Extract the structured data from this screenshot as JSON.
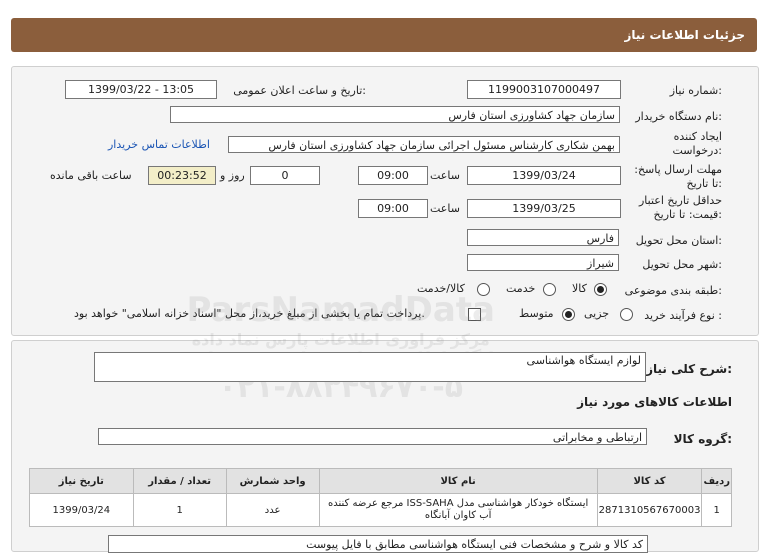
{
  "header": {
    "title": "جزئیات اطلاعات نیاز"
  },
  "form": {
    "need_number_label": "شماره نیاز:",
    "need_number": "1199003107000497",
    "announce_label": "تاریخ و ساعت اعلان عمومی:",
    "announce_value": "1399/03/22 - 13:05",
    "buyer_org_label": "نام دستگاه خریدار:",
    "buyer_org": "سازمان جهاد کشاورزی استان فارس",
    "creator_label": "ایجاد کننده درخواست:",
    "creator": "بهمن شکاری کارشناس مسئول اجرائی سازمان جهاد کشاورزی استان فارس",
    "contact_link": "اطلاعات تماس خریدار",
    "send_deadline_label": "مهلت ارسال پاسخ: تا تاریخ:",
    "send_date": "1399/03/24",
    "time_label": "ساعت",
    "send_time": "09:00",
    "days_value": "0",
    "days_label": "روز و",
    "remaining": "00:23:52",
    "remaining_label": "ساعت باقی مانده",
    "validity_label": "حداقل تاریخ اعتبار قیمت: تا تاریخ:",
    "validity_date": "1399/03/25",
    "validity_time": "09:00",
    "province_label": "استان محل تحویل:",
    "province": "فارس",
    "city_label": "شهر محل تحویل:",
    "city": "شیراز",
    "category_label": "طبقه بندی موضوعی:",
    "category_options": [
      "کالا",
      "خدمت",
      "کالا/خدمت"
    ],
    "process_label": "نوع فرآیند خرید :",
    "process_options": [
      "جزیی",
      "متوسط"
    ],
    "payment_note": "پرداخت تمام یا بخشی از مبلغ خرید،از محل \"اسناد خزانه اسلامی\" خواهد بود."
  },
  "summary": {
    "desc_label": "شرح کلی نیاز:",
    "desc_value": "لوازم ایستگاه هواشناسی",
    "goods_info_title": "اطلاعات کالاهای مورد نیاز",
    "group_label": "گروه کالا:",
    "group_value": "ارتباطی و مخابراتی",
    "watermark_lines": [
      "ParsNamadData",
      "مرکز فراوری اطلاعات پارس نماد داده",
      "پایگاه اطلاع رسانی مناقصه و مزایده",
      "۰۲۱-۸۸۳۴۹۶۷۰-۵"
    ]
  },
  "table": {
    "headers": [
      "ردیف",
      "کد کالا",
      "نام کالا",
      "واحد شمارش",
      "تعداد / مقدار",
      "تاریخ نیاز"
    ],
    "rows": [
      {
        "idx": "1",
        "code": "2871310567670003",
        "name": "ایستگاه خودکار هواشناسی مدل ISS-SAHA مرجع عرضه کننده آب کاوان آبانگاه",
        "unit": "عدد",
        "qty": "1",
        "date": "1399/03/24"
      }
    ]
  },
  "footer_note": "کد کالا و شرح و مشخصات فنی ایستگاه هواشناسی مطابق با فایل پیوست"
}
